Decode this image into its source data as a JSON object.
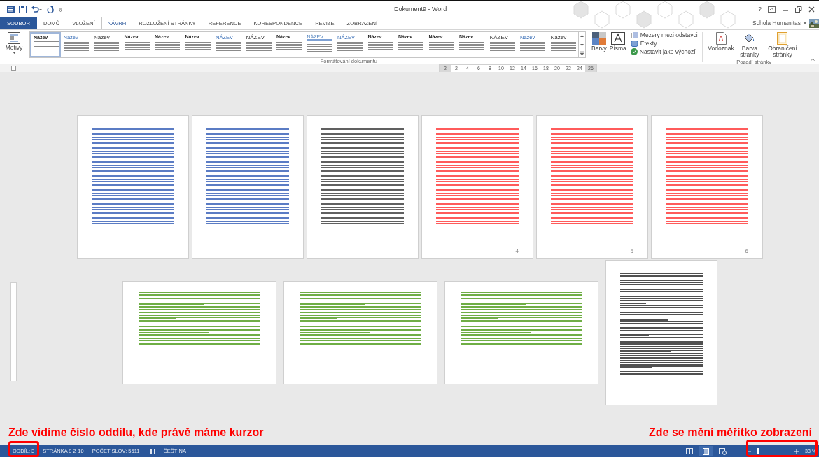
{
  "window": {
    "title": "Dokument9 - Word",
    "help": "?",
    "user": "Schola Humanitas"
  },
  "tabs": [
    {
      "label": "SOUBOR",
      "kind": "file",
      "selected": false
    },
    {
      "label": "DOMŮ",
      "kind": "tab",
      "selected": false
    },
    {
      "label": "VLOŽENÍ",
      "kind": "tab",
      "selected": false
    },
    {
      "label": "NÁVRH",
      "kind": "tab",
      "selected": true
    },
    {
      "label": "ROZLOŽENÍ STRÁNKY",
      "kind": "tab",
      "selected": false
    },
    {
      "label": "REFERENCE",
      "kind": "tab",
      "selected": false
    },
    {
      "label": "KORESPONDENCE",
      "kind": "tab",
      "selected": false
    },
    {
      "label": "REVIZE",
      "kind": "tab",
      "selected": false
    },
    {
      "label": "ZOBRAZENÍ",
      "kind": "tab",
      "selected": false
    }
  ],
  "ribbon": {
    "themes": "Motivy",
    "gallery": [
      {
        "title": "Název",
        "kind": "plain",
        "selected": true
      },
      {
        "title": "Název",
        "kind": "accent",
        "selected": false
      },
      {
        "title": "Název",
        "kind": "large",
        "selected": false
      },
      {
        "title": "Název",
        "kind": "plain",
        "selected": false
      },
      {
        "title": "Název",
        "kind": "plain",
        "selected": false
      },
      {
        "title": "Název",
        "kind": "plain",
        "selected": false
      },
      {
        "title": "NÁZEV",
        "kind": "accent",
        "selected": false
      },
      {
        "title": "NÁZEV",
        "kind": "large",
        "selected": false
      },
      {
        "title": "Název",
        "kind": "plain",
        "selected": false
      },
      {
        "title": "NÁZEV",
        "kind": "banded",
        "selected": false
      },
      {
        "title": "NÁZEV",
        "kind": "accent",
        "selected": false
      },
      {
        "title": "Název",
        "kind": "plain",
        "selected": false
      },
      {
        "title": "Název",
        "kind": "plain",
        "selected": false
      },
      {
        "title": "Název",
        "kind": "plain",
        "selected": false
      },
      {
        "title": "Název",
        "kind": "plain",
        "selected": false
      },
      {
        "title": "NÁZEV",
        "kind": "large",
        "selected": false
      },
      {
        "title": "Název",
        "kind": "accent",
        "selected": false
      },
      {
        "title": "Název",
        "kind": "large",
        "selected": false
      }
    ],
    "colors": "Barvy",
    "fonts": "Písma",
    "spacing": "Mezery mezi odstavci",
    "effects": "Efekty",
    "set_default": "Nastavit jako výchozí",
    "group_format": "Formátování dokumentu",
    "watermark": "Vodoznak",
    "page_color": "Barva stránky",
    "page_borders": "Ohraničení stránky",
    "group_background": "Pozadí stránky"
  },
  "ruler": [
    "2",
    "2",
    "4",
    "6",
    "8",
    "10",
    "12",
    "14",
    "16",
    "18",
    "20",
    "22",
    "24",
    "26"
  ],
  "pages": [
    {
      "kind": "portrait",
      "color": "#5b7cc4"
    },
    {
      "kind": "portrait",
      "color": "#5b7cc4"
    },
    {
      "kind": "portrait",
      "color": "#606060"
    },
    {
      "kind": "portrait",
      "color": "#ff5b5b",
      "number": "4"
    },
    {
      "kind": "portrait",
      "color": "#ff5b5b",
      "number": "5"
    },
    {
      "kind": "portrait",
      "color": "#ff5b5b",
      "number": "6"
    },
    {
      "kind": "landscape",
      "color": "#6fae45"
    },
    {
      "kind": "landscape",
      "color": "#6fae45"
    },
    {
      "kind": "landscape",
      "color": "#6fae45"
    },
    {
      "kind": "portrait",
      "color": "#505050"
    }
  ],
  "annotations": [
    "Zde vidíme číslo oddílu, kde právě máme kurzor",
    "Zde se mění měřítko zobrazení"
  ],
  "status": {
    "section": "ODDÍL: 3",
    "page": "STRÁNKA 9 Z 10",
    "words": "POČET SLOV: 5511",
    "language": "ČEŠTINA",
    "views": [
      {
        "kind": "read",
        "selected": false
      },
      {
        "kind": "print",
        "selected": true
      },
      {
        "kind": "web",
        "selected": false
      }
    ],
    "zoom": {
      "level": 0.12,
      "reading": "33 %"
    }
  }
}
